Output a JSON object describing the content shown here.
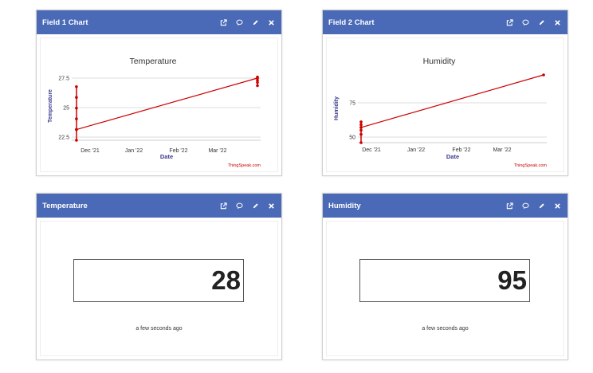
{
  "icons": [
    "external-link-icon",
    "comment-icon",
    "pencil-icon",
    "close-icon"
  ],
  "header_color": "#4a6ab8",
  "chart_widgets": [
    {
      "header": "Field 1 Chart",
      "credit": "ThingSpeak.com",
      "chart_data": {
        "type": "line",
        "title": "Temperature",
        "xlabel": "Date",
        "ylabel": "Temperature",
        "x_ticks": [
          "Dec '21",
          "Jan '22",
          "Feb '22",
          "Mar '22"
        ],
        "y_ticks": [
          "27.5",
          "25",
          "22.5"
        ],
        "ylim": [
          22,
          27.8
        ],
        "color": "#cc0000",
        "series": [
          {
            "x": [
              "2021-11-30",
              "2021-11-30",
              "2021-11-30",
              "2021-11-30",
              "2021-11-30",
              "2021-11-30",
              "2021-11-30",
              "2022-03-29",
              "2022-03-29",
              "2022-03-29",
              "2022-03-29",
              "2022-03-29"
            ],
            "y": [
              22,
              23,
              24,
              25,
              26,
              27,
              23,
              27.8,
              27.6,
              27.4,
              27.1,
              27.9
            ]
          }
        ]
      }
    },
    {
      "header": "Field 2 Chart",
      "credit": "ThingSpeak.com",
      "chart_data": {
        "type": "line",
        "title": "Humidity",
        "xlabel": "Date",
        "ylabel": "Humidity",
        "x_ticks": [
          "Dec '21",
          "Jan '22",
          "Feb '22",
          "Mar '22"
        ],
        "y_ticks": [
          "75",
          "50"
        ],
        "ylim": [
          46,
          95
        ],
        "color": "#cc0000",
        "series": [
          {
            "x": [
              "2021-11-29",
              "2021-11-29",
              "2021-11-29",
              "2021-11-29",
              "2021-11-29",
              "2021-11-29",
              "2021-11-29",
              "2022-03-29"
            ],
            "y": [
              46,
              52,
              55,
              57,
              59,
              61,
              57,
              95
            ]
          }
        ]
      }
    }
  ],
  "value_widgets": [
    {
      "header": "Temperature",
      "value": "28",
      "updated": "a few seconds ago"
    },
    {
      "header": "Humidity",
      "value": "95",
      "updated": "a few seconds ago"
    }
  ]
}
